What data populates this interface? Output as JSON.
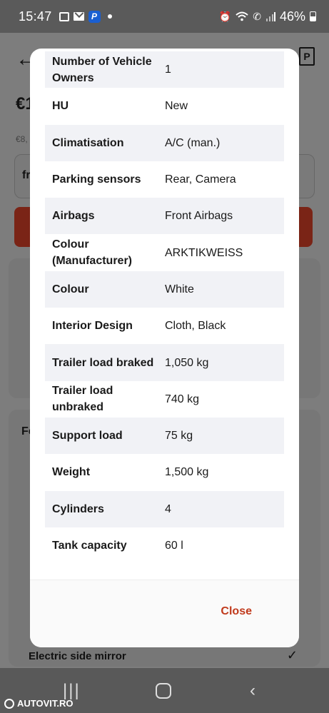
{
  "status_bar": {
    "time": "15:47",
    "battery": "46%",
    "icons": [
      "gallery-icon",
      "mail-icon",
      "paypal-icon",
      "dot-icon",
      "alarm-icon",
      "wifi-icon",
      "call-icon",
      "signal-icon",
      "battery-icon"
    ]
  },
  "background": {
    "price_prefix": "€1",
    "sub_prefix": "€8,",
    "box_prefix": "fr",
    "section_prefix": "Fe",
    "mirror_label": "Electric side mirror"
  },
  "specs": [
    {
      "key": "Number of Vehicle Owners",
      "value": "1"
    },
    {
      "key": "HU",
      "value": "New"
    },
    {
      "key": "Climatisation",
      "value": "A/C (man.)"
    },
    {
      "key": "Parking sensors",
      "value": "Rear, Camera"
    },
    {
      "key": "Airbags",
      "value": "Front Airbags"
    },
    {
      "key": "Colour (Manufacturer)",
      "value": "ARKTIKWEISS"
    },
    {
      "key": "Colour",
      "value": "White"
    },
    {
      "key": "Interior Design",
      "value": "Cloth, Black"
    },
    {
      "key": "Trailer load braked",
      "value": "1,050 kg"
    },
    {
      "key": "Trailer load unbraked",
      "value": "740 kg"
    },
    {
      "key": "Support load",
      "value": "75 kg"
    },
    {
      "key": "Weight",
      "value": "1,500 kg"
    },
    {
      "key": "Cylinders",
      "value": "4"
    },
    {
      "key": "Tank capacity",
      "value": "60 l"
    }
  ],
  "modal": {
    "close_label": "Close",
    "accent_color": "#c0391b"
  },
  "watermark": "AUTOVIT.RO"
}
